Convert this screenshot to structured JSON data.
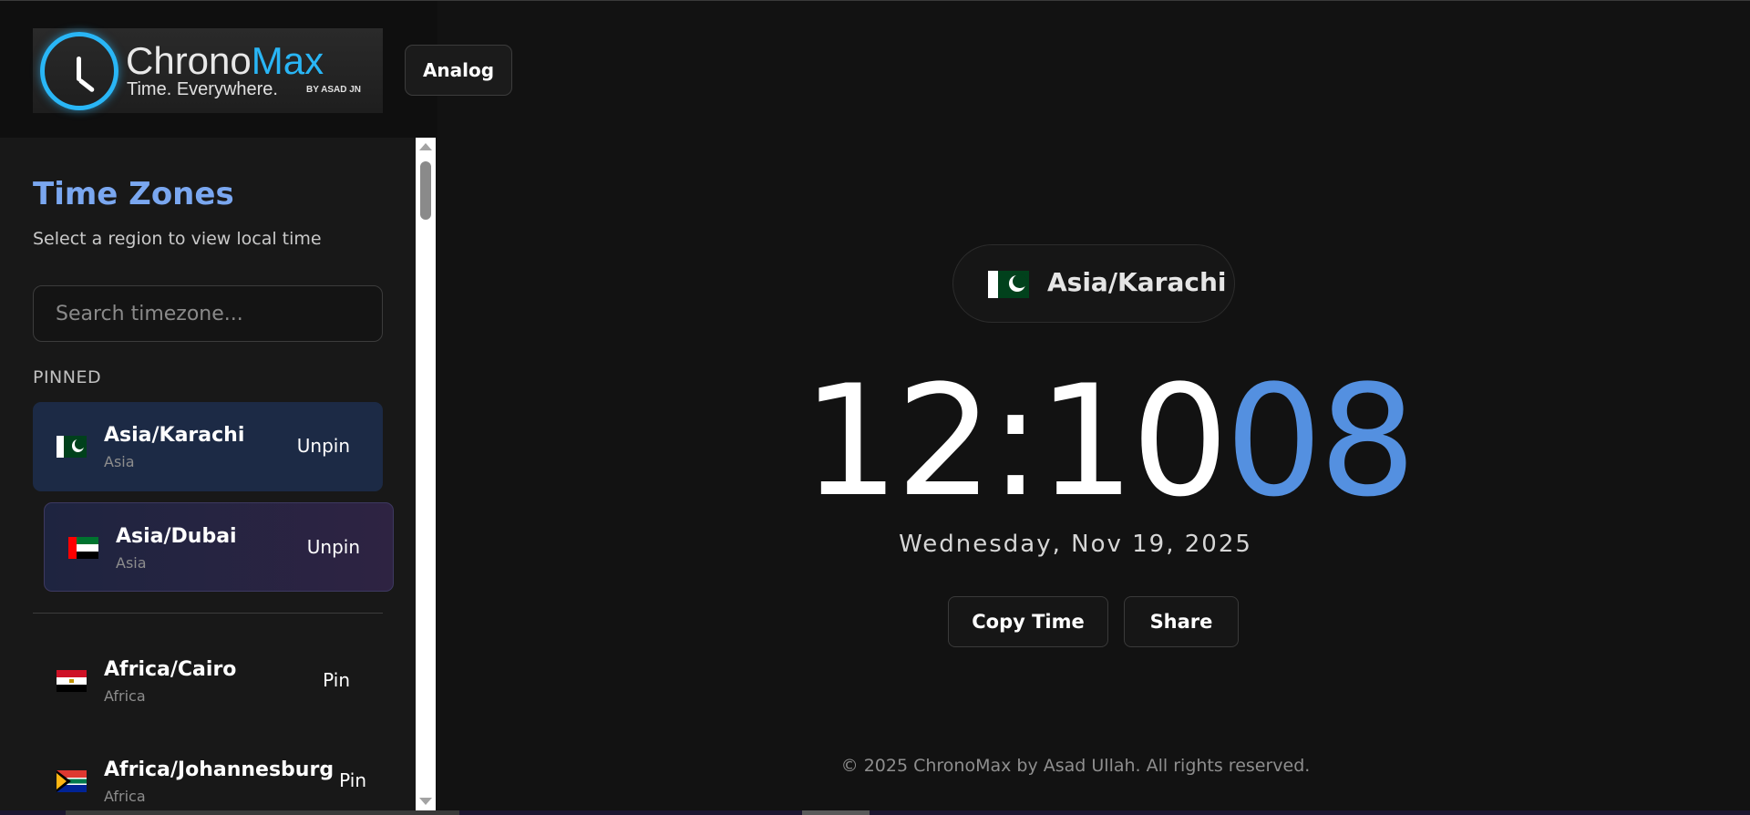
{
  "app": {
    "logo_name_part1": "Chrono",
    "logo_name_part2": "Max",
    "logo_tagline": "Time. Everywhere.",
    "logo_byline": "BY ASAD JN",
    "mode_button": "Analog"
  },
  "sidebar": {
    "title": "Time Zones",
    "subtitle": "Select a region to view local time",
    "search_placeholder": "Search timezone...",
    "pinned_label": "PINNED",
    "pinned": [
      {
        "name": "Asia/Karachi",
        "region": "Asia",
        "action": "Unpin",
        "flag": "pk-flag"
      },
      {
        "name": "Asia/Dubai",
        "region": "Asia",
        "action": "Unpin",
        "flag": "ae-flag"
      }
    ],
    "zones": [
      {
        "name": "Africa/Cairo",
        "region": "Africa",
        "action": "Pin",
        "flag": "eg-flag"
      },
      {
        "name": "Africa/Johannesburg",
        "region": "Africa",
        "action": "Pin",
        "flag": "za-flag"
      }
    ]
  },
  "clock": {
    "selected_zone": "Asia/Karachi",
    "hours_minutes": "12:10",
    "seconds": "08",
    "date": "Wednesday, Nov 19, 2025",
    "copy_button": "Copy Time",
    "share_button": "Share"
  },
  "footer": {
    "text": "© 2025 ChronoMax by Asad Ullah. All rights reserved."
  },
  "colors": {
    "background": "#121212",
    "accent_blue": "#5490e0",
    "title_blue": "#7aa7f0",
    "logo_cyan": "#29b6f6"
  }
}
